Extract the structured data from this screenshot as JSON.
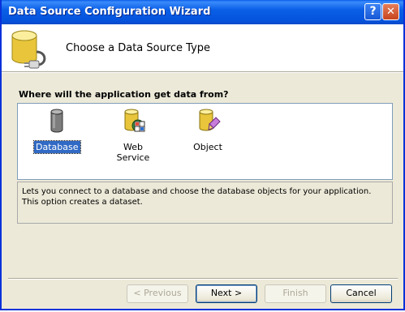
{
  "window": {
    "title": "Data Source Configuration Wizard",
    "help_label": "?",
    "close_label": "✕"
  },
  "header": {
    "title": "Choose a Data Source Type"
  },
  "main": {
    "question": "Where will the application get data from?",
    "choices": [
      {
        "label": "Database",
        "icon": "database-icon",
        "selected": true
      },
      {
        "label": "Web Service",
        "icon": "web-service-icon",
        "selected": false
      },
      {
        "label": "Object",
        "icon": "object-icon",
        "selected": false
      }
    ],
    "description": "Lets you connect to a database and choose the database objects for your application. This option creates a dataset."
  },
  "buttons": {
    "previous": "< Previous",
    "next": "Next >",
    "finish": "Finish",
    "cancel": "Cancel"
  },
  "colors": {
    "titlebar": "#0a5fe6",
    "selection": "#316ac5",
    "dialog_bg": "#ece9d8"
  }
}
